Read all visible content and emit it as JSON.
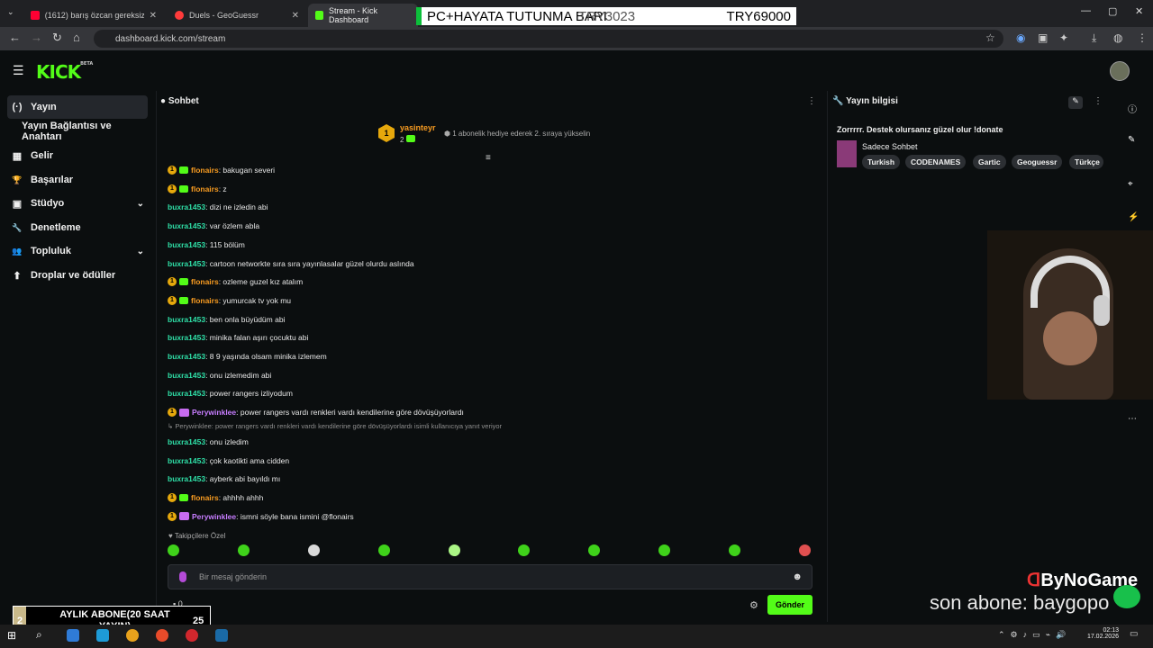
{
  "browser": {
    "tabs": [
      {
        "label": "(1612) barış özcan gereksiz sanı",
        "color": "#ff0033"
      },
      {
        "label": "Duels - GeoGuessr",
        "color": "#ff3b3b"
      },
      {
        "label": "Stream - Kick Dashboard",
        "color": "#53fc18"
      }
    ],
    "url": "dashboard.kick.com/stream"
  },
  "overlay_bar": {
    "left": "PC+HAYATA TUTUNMA BARI",
    "middle": "TRY3023",
    "right": "TRY69000"
  },
  "sidebar": {
    "items": [
      {
        "label": "Yayın",
        "icon": "broadcast-icon",
        "glyph": "(·)"
      },
      {
        "label": "Yayın Bağlantısı ve Anahtarı",
        "icon": "",
        "glyph": ""
      },
      {
        "label": "Gelir",
        "icon": "chart-icon",
        "glyph": "▦"
      },
      {
        "label": "Başarılar",
        "icon": "trophy-icon",
        "glyph": "🏆"
      },
      {
        "label": "Stüdyo",
        "icon": "studio-icon",
        "glyph": "▣"
      },
      {
        "label": "Denetleme",
        "icon": "wrench-icon",
        "glyph": "🔧"
      },
      {
        "label": "Topluluk",
        "icon": "community-icon",
        "glyph": "👥"
      },
      {
        "label": "Droplar ve ödüller",
        "icon": "gift-icon",
        "glyph": "⬆"
      }
    ]
  },
  "chat": {
    "title": "Sohbet",
    "pinned_user": "yasinteyr",
    "pinned_count": "2",
    "pinned_rank": "1",
    "gift_hint": "1 abonelik hediye ederek 2. sıraya yükselin",
    "messages": [
      {
        "user": "flonairs",
        "text": ": bakugan severi",
        "color": "u-orange",
        "badges": [
          "b1",
          "b2"
        ]
      },
      {
        "user": "flonairs",
        "text": ": z",
        "color": "u-orange",
        "badges": [
          "b1",
          "b2"
        ]
      },
      {
        "user": "buxra1453",
        "text": ": dizi ne izledin abi",
        "color": "u-teal",
        "badges": []
      },
      {
        "user": "buxra1453",
        "text": ": var özlem abla",
        "color": "u-teal",
        "badges": []
      },
      {
        "user": "buxra1453",
        "text": ": 115 bölüm",
        "color": "u-teal",
        "badges": []
      },
      {
        "user": "buxra1453",
        "text": ": cartoon networkte sıra sıra yayınlasalar güzel olurdu aslında",
        "color": "u-teal",
        "badges": []
      },
      {
        "user": "flonairs",
        "text": ": ozleme guzel kız atalım",
        "color": "u-orange",
        "badges": [
          "b1",
          "b2"
        ]
      },
      {
        "user": "flonairs",
        "text": ": yumurcak tv yok mu",
        "color": "u-orange",
        "badges": [
          "b1",
          "b2"
        ]
      },
      {
        "user": "buxra1453",
        "text": ": ben onla büyüdüm abi",
        "color": "u-teal",
        "badges": []
      },
      {
        "user": "buxra1453",
        "text": ": minika falan aşırı çocuktu abi",
        "color": "u-teal",
        "badges": []
      },
      {
        "user": "buxra1453",
        "text": ": 8 9 yaşında olsam minika izlemem",
        "color": "u-teal",
        "badges": []
      },
      {
        "user": "buxra1453",
        "text": ": onu izlemedim abi",
        "color": "u-teal",
        "badges": []
      },
      {
        "user": "buxra1453",
        "text": ": power rangers izliyodum",
        "color": "u-teal",
        "badges": []
      },
      {
        "user": "Perywinklee",
        "text": ": power rangers vardı renkleri vardı kendilerine göre dövüşüyorlardı",
        "color": "u-purple",
        "badges": [
          "b1",
          "b3"
        ]
      },
      {
        "user": "buxra1453",
        "text": ": onu izledim",
        "color": "u-teal",
        "badges": [],
        "reply": "Perywinklee: power rangers vardı renkleri vardı kendilerine göre dövüşüyorlardı isimli kullanıcıya yanıt veriyor"
      },
      {
        "user": "buxra1453",
        "text": ": çok kaotikti ama cidden",
        "color": "u-teal",
        "badges": []
      },
      {
        "user": "buxra1453",
        "text": ": ayberk abi bayıldı mı",
        "color": "u-teal",
        "badges": []
      },
      {
        "user": "flonairs",
        "text": ": ahhhh ahhh",
        "color": "u-orange",
        "badges": [
          "b1",
          "b2"
        ]
      },
      {
        "user": "Perywinklee",
        "text": ": ismni söyle bana ismini @flonairs",
        "color": "u-purple",
        "badges": [
          "b1",
          "b3"
        ]
      }
    ],
    "emote_section_label": "Takipçilere Özel",
    "input_placeholder": "Bir mesaj gönderin",
    "send_label": "Gönder",
    "viewer_count": "0"
  },
  "stream_info": {
    "title": "Yayın bilgisi",
    "stream_title": "Zorrrrr. Destek olursanız güzel olur !donate",
    "category": "Sadece Sohbet",
    "tags": [
      "Turkish",
      "CODENAMES",
      "Gartic",
      "Geoguessr",
      "Türkçe"
    ]
  },
  "overlays": {
    "sub_count": "2",
    "sub_label": "AYLIK ABONE(20 SAAT YAYIN)",
    "sub_goal": "25",
    "last_sub": "son abone: baygopo",
    "brand": "ByNoGame"
  },
  "taskbar": {
    "time": "02:13",
    "date": "17.02.2026"
  }
}
